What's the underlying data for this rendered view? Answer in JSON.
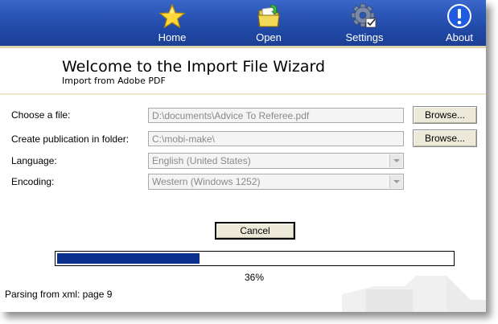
{
  "toolbar": {
    "items": [
      {
        "label": "Home",
        "icon": "star-icon"
      },
      {
        "label": "Open",
        "icon": "folder-icon"
      },
      {
        "label": "Settings",
        "icon": "gear-icon"
      },
      {
        "label": "About",
        "icon": "info-icon"
      }
    ]
  },
  "header": {
    "title": "Welcome to the Import File Wizard",
    "subtitle": "Import from Adobe PDF"
  },
  "form": {
    "file_label": "Choose a file:",
    "file_value": "D:\\documents\\Advice To Referee.pdf",
    "folder_label": "Create publication in folder:",
    "folder_value": "C:\\mobi-make\\",
    "language_label": "Language:",
    "language_value": "English (United States)",
    "encoding_label": "Encoding:",
    "encoding_value": "Western (Windows 1252)",
    "browse_label": "Browse..."
  },
  "actions": {
    "cancel_label": "Cancel"
  },
  "progress": {
    "fraction": 0.36,
    "percent_text": "36%",
    "status_text": "Parsing from xml: page 9"
  },
  "colors": {
    "toolbar": "#2a55b6",
    "progress_fill": "#0a2f8c"
  }
}
